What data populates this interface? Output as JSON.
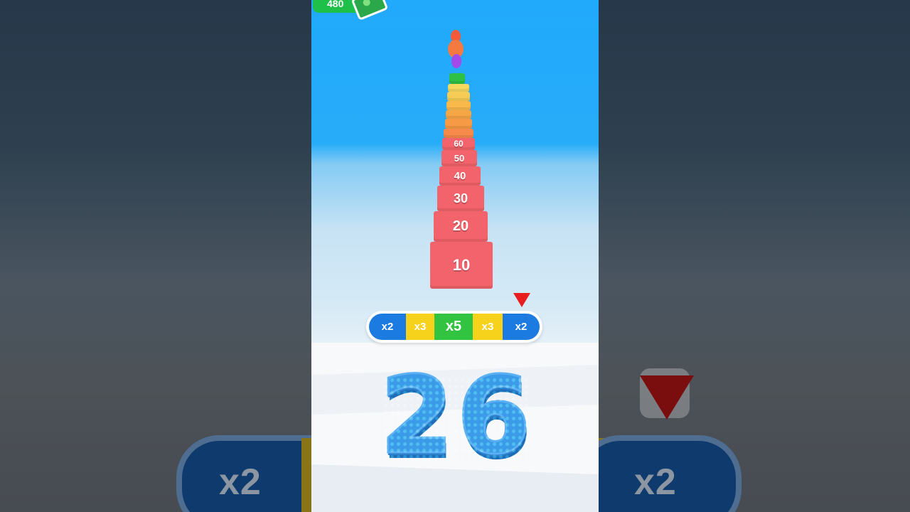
{
  "hud": {
    "money": "480",
    "money_icon": "cash-stack-icon"
  },
  "tower": {
    "blocks": [
      {
        "label": "10",
        "color": "#f2636b"
      },
      {
        "label": "20",
        "color": "#f2636b"
      },
      {
        "label": "30",
        "color": "#f2636b"
      },
      {
        "label": "40",
        "color": "#f2636b"
      },
      {
        "label": "50",
        "color": "#f2636b"
      },
      {
        "label": "60",
        "color": "#f2636b"
      },
      {
        "label": "",
        "color": "#f58a4a"
      },
      {
        "label": "",
        "color": "#f79a45"
      },
      {
        "label": "",
        "color": "#f7a645"
      },
      {
        "label": "",
        "color": "#f8b84a"
      },
      {
        "label": "",
        "color": "#f7cc55"
      },
      {
        "label": "",
        "color": "#f6d85e"
      },
      {
        "label": "",
        "color": "#2fc046"
      }
    ]
  },
  "multipliers": [
    {
      "label": "x2",
      "color": "#1b7be0"
    },
    {
      "label": "x3",
      "color": "#f6d21c"
    },
    {
      "label": "x5",
      "color": "#32c340"
    },
    {
      "label": "x3",
      "color": "#f6d21c"
    },
    {
      "label": "x2",
      "color": "#1b7be0"
    }
  ],
  "crowd_count": "26",
  "background_multiplier_left": "x2",
  "background_multiplier_right": "x2"
}
